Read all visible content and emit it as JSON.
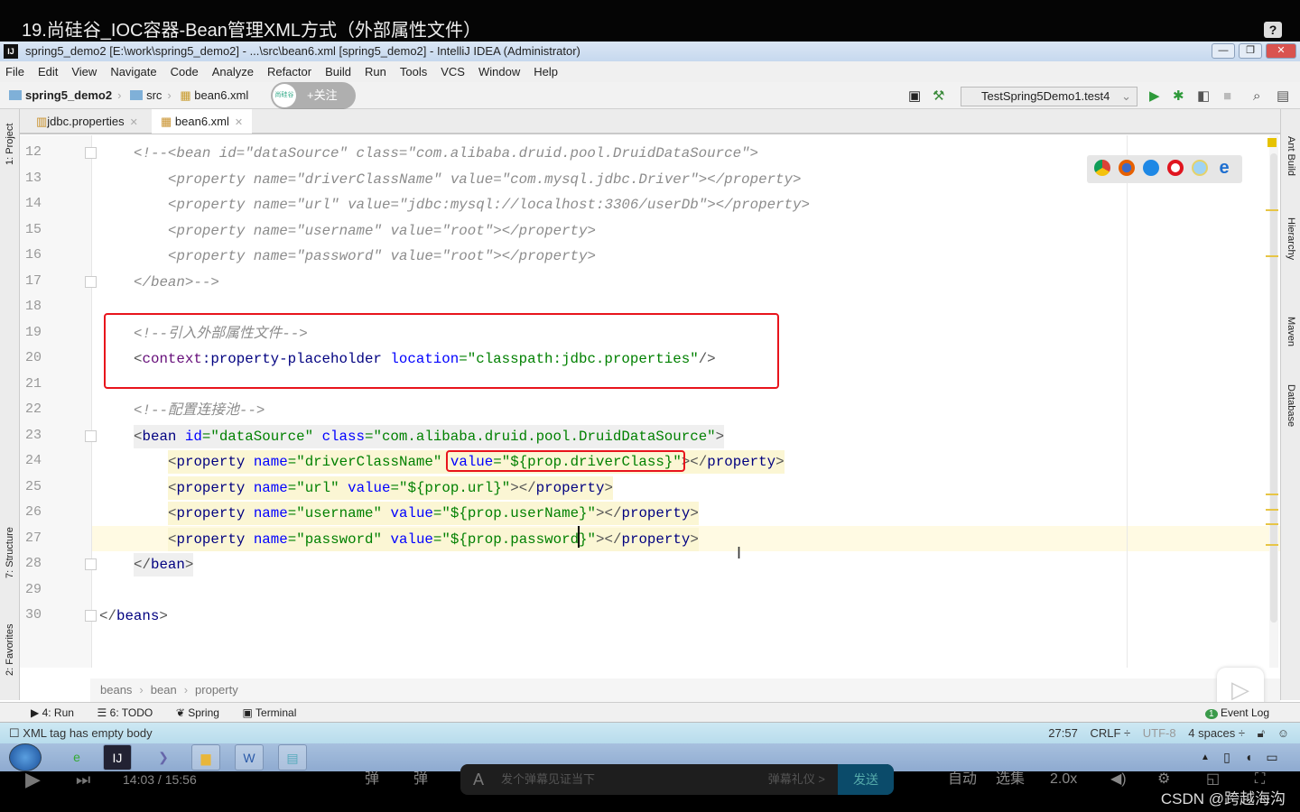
{
  "video": {
    "title": "19.尚硅谷_IOC容器-Bean管理XML方式（外部属性文件）",
    "help": "?",
    "time": "14:03 / 15:56",
    "danmu_placeholder": "发个弹幕见证当下",
    "danmu_etiquette": "弹幕礼仪 >",
    "send": "发送",
    "auto": "自动",
    "episodes": "选集",
    "speed": "2.0x",
    "watermark": "CSDN @跨越海沟",
    "follow": "+关注",
    "logo_text": "尚硅谷"
  },
  "window": {
    "title": "spring5_demo2 [E:\\work\\spring5_demo2] - ...\\src\\bean6.xml [spring5_demo2] - IntelliJ IDEA (Administrator)",
    "logo": "IJ",
    "min": "—",
    "max": "❐",
    "close": "✕"
  },
  "menu": [
    "File",
    "Edit",
    "View",
    "Navigate",
    "Code",
    "Analyze",
    "Refactor",
    "Build",
    "Run",
    "Tools",
    "VCS",
    "Window",
    "Help"
  ],
  "nav": {
    "project": "spring5_demo2",
    "src": "src",
    "file": "bean6.xml",
    "run_config": "TestSpring5Demo1.test4"
  },
  "tabs": [
    {
      "label": "jdbc.properties",
      "active": false
    },
    {
      "label": "bean6.xml",
      "active": true
    }
  ],
  "left_tools": [
    "1: Project",
    "7: Structure",
    "2: Favorites"
  ],
  "right_tools": [
    "Ant Build",
    "Hierarchy",
    "Maven",
    "Database"
  ],
  "code": [
    {
      "n": "12",
      "indent": 1,
      "hl": "",
      "t": [
        [
          "<!--<bean id=\"dataSource\" class=\"com.alibaba.druid.pool.DruidDataSource\">",
          "com"
        ]
      ]
    },
    {
      "n": "13",
      "indent": 2,
      "hl": "",
      "t": [
        [
          "<property name=\"driverClassName\" value=\"com.mysql.jdbc.Driver\"></property>",
          "com"
        ]
      ]
    },
    {
      "n": "14",
      "indent": 2,
      "hl": "",
      "t": [
        [
          "<property name=\"url\" value=\"jdbc:mysql://localhost:3306/userDb\"></property>",
          "com"
        ]
      ]
    },
    {
      "n": "15",
      "indent": 2,
      "hl": "",
      "t": [
        [
          "<property name=\"username\" value=\"root\"></property>",
          "com"
        ]
      ]
    },
    {
      "n": "16",
      "indent": 2,
      "hl": "",
      "t": [
        [
          "<property name=\"password\" value=\"root\"></property>",
          "com"
        ]
      ]
    },
    {
      "n": "17",
      "indent": 1,
      "hl": "",
      "t": [
        [
          "</bean>-->",
          "com"
        ]
      ]
    },
    {
      "n": "18",
      "indent": 0,
      "hl": "",
      "t": []
    },
    {
      "n": "19",
      "indent": 1,
      "hl": "",
      "t": [
        [
          "<!--引入外部属性文件-->",
          "com"
        ]
      ]
    },
    {
      "n": "20",
      "indent": 1,
      "hl": "",
      "t": [
        [
          "<",
          "br"
        ],
        [
          "context",
          "ns"
        ],
        [
          ":property-placeholder ",
          "tag"
        ],
        [
          "location",
          "attr"
        ],
        [
          "=\"classpath:jdbc.properties\"",
          "val"
        ],
        [
          "/>",
          "br"
        ]
      ]
    },
    {
      "n": "21",
      "indent": 0,
      "hl": "",
      "t": []
    },
    {
      "n": "22",
      "indent": 1,
      "hl": "",
      "t": [
        [
          "<!--配置连接池-->",
          "com"
        ]
      ]
    },
    {
      "n": "23",
      "indent": 1,
      "hl": "bean",
      "t": [
        [
          "<",
          "br"
        ],
        [
          "bean ",
          "tag"
        ],
        [
          "id",
          "attr"
        ],
        [
          "=\"dataSource\" ",
          "val"
        ],
        [
          "class",
          "attr"
        ],
        [
          "=\"com.alibaba.druid.pool.DruidDataSource\"",
          "val"
        ],
        [
          ">",
          "br"
        ]
      ]
    },
    {
      "n": "24",
      "indent": 2,
      "hl": "prop",
      "t": [
        [
          "<",
          "br"
        ],
        [
          "property ",
          "tag"
        ],
        [
          "name",
          "attr"
        ],
        [
          "=\"driverClassName\" ",
          "val"
        ],
        [
          "value",
          "attr"
        ],
        [
          "=\"${prop.driverClass}\"",
          "val"
        ],
        [
          "></",
          "br"
        ],
        [
          "property",
          "tag"
        ],
        [
          ">",
          "br"
        ]
      ]
    },
    {
      "n": "25",
      "indent": 2,
      "hl": "prop",
      "t": [
        [
          "<",
          "br"
        ],
        [
          "property ",
          "tag"
        ],
        [
          "name",
          "attr"
        ],
        [
          "=\"url\" ",
          "val"
        ],
        [
          "value",
          "attr"
        ],
        [
          "=\"${prop.url}\"",
          "val"
        ],
        [
          "></",
          "br"
        ],
        [
          "property",
          "tag"
        ],
        [
          ">",
          "br"
        ]
      ]
    },
    {
      "n": "26",
      "indent": 2,
      "hl": "prop",
      "t": [
        [
          "<",
          "br"
        ],
        [
          "property ",
          "tag"
        ],
        [
          "name",
          "attr"
        ],
        [
          "=\"username\" ",
          "val"
        ],
        [
          "value",
          "attr"
        ],
        [
          "=\"${prop.userName}\"",
          "val"
        ],
        [
          "></",
          "br"
        ],
        [
          "property",
          "tag"
        ],
        [
          ">",
          "br"
        ]
      ]
    },
    {
      "n": "27",
      "indent": 2,
      "hl": "prop",
      "t": [
        [
          "<",
          "br"
        ],
        [
          "property ",
          "tag"
        ],
        [
          "name",
          "attr"
        ],
        [
          "=\"password\" ",
          "val"
        ],
        [
          "value",
          "attr"
        ],
        [
          "=\"${prop.password}\"",
          "val"
        ],
        [
          "></",
          "br"
        ],
        [
          "property",
          "tag"
        ],
        [
          ">",
          "br"
        ]
      ]
    },
    {
      "n": "28",
      "indent": 1,
      "hl": "bean",
      "t": [
        [
          "</",
          "br"
        ],
        [
          "bean",
          "tag"
        ],
        [
          ">",
          "br"
        ]
      ]
    },
    {
      "n": "29",
      "indent": 0,
      "hl": "",
      "t": []
    },
    {
      "n": "30",
      "indent": 0,
      "hl": "",
      "t": [
        [
          "</",
          "br"
        ],
        [
          "beans",
          "tag"
        ],
        [
          ">",
          "br"
        ]
      ]
    }
  ],
  "breadcrumb": [
    "beans",
    "bean",
    "property"
  ],
  "toolwindows": [
    "4: Run",
    "6: TODO",
    "Spring",
    "Terminal"
  ],
  "event_log": {
    "count": "1",
    "label": "Event Log"
  },
  "status": {
    "message": "XML tag has empty body",
    "position": "27:57",
    "line_sep": "CRLF ÷",
    "encoding": "UTF-8",
    "indent": "4 spaces ÷"
  },
  "colors": {
    "highlight_box": "#e8141c",
    "tag": "#000080",
    "attr": "#0000ff",
    "value": "#008000",
    "comment": "#8c8c8c"
  }
}
